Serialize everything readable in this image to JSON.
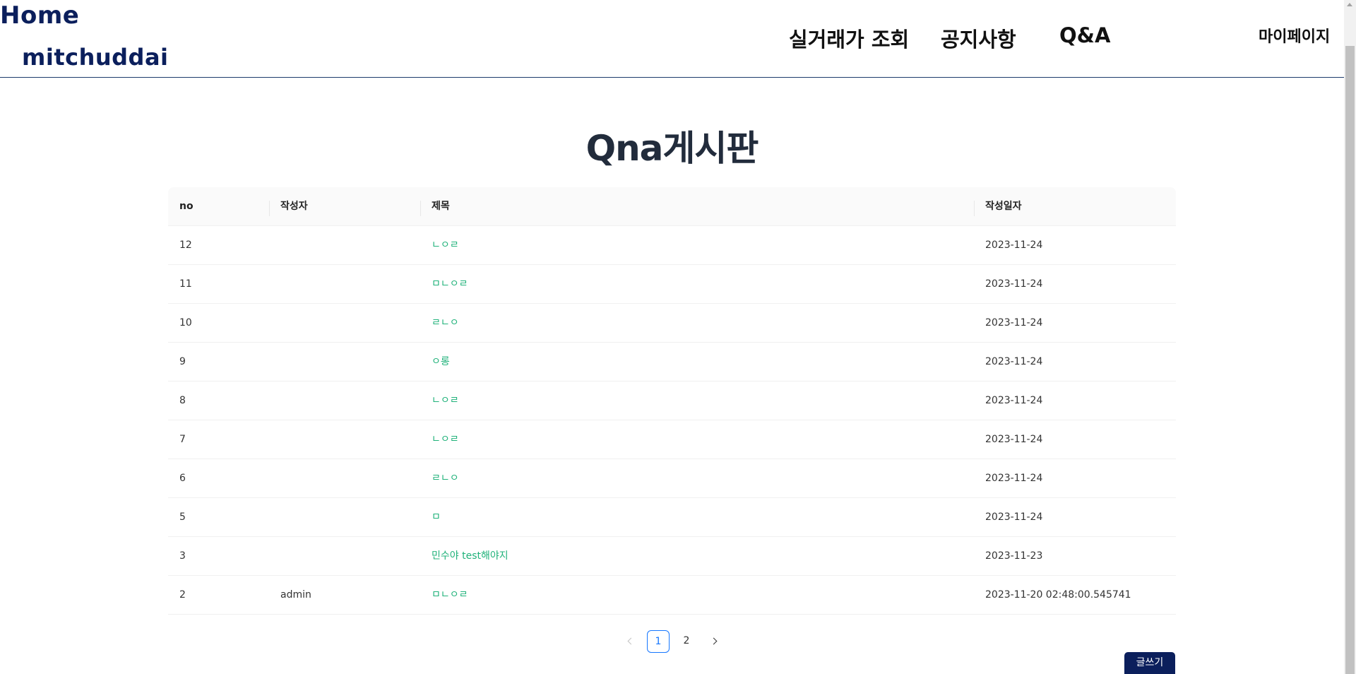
{
  "header": {
    "logo_line1": "Home",
    "logo_line2": "mitchuddai",
    "nav": {
      "trade": "실거래가 조회",
      "notice": "공지사항",
      "qna": "Q&A"
    },
    "mypage": "마이페이지"
  },
  "page_title": "Qna게시판",
  "table": {
    "columns": {
      "no": "no",
      "writer": "작성자",
      "title": "제목",
      "date": "작성일자"
    },
    "rows": [
      {
        "no": "12",
        "writer": "",
        "title": "ㄴㅇㄹ",
        "date": "2023-11-24"
      },
      {
        "no": "11",
        "writer": "",
        "title": "ㅁㄴㅇㄹ",
        "date": "2023-11-24"
      },
      {
        "no": "10",
        "writer": "",
        "title": "ㄹㄴㅇ",
        "date": "2023-11-24"
      },
      {
        "no": "9",
        "writer": "",
        "title": "ㅇ롱",
        "date": "2023-11-24"
      },
      {
        "no": "8",
        "writer": "",
        "title": "ㄴㅇㄹ",
        "date": "2023-11-24"
      },
      {
        "no": "7",
        "writer": "",
        "title": "ㄴㅇㄹ",
        "date": "2023-11-24"
      },
      {
        "no": "6",
        "writer": "",
        "title": "ㄹㄴㅇ",
        "date": "2023-11-24"
      },
      {
        "no": "5",
        "writer": "",
        "title": "ㅁ",
        "date": "2023-11-24"
      },
      {
        "no": "3",
        "writer": "",
        "title": "민수야 test해야지",
        "date": "2023-11-23"
      },
      {
        "no": "2",
        "writer": "admin",
        "title": "ㅁㄴㅇㄹ",
        "date": "2023-11-20 02:48:00.545741"
      }
    ]
  },
  "pagination": {
    "pages": [
      "1",
      "2"
    ],
    "current": "1"
  },
  "write_button": "글쓰기",
  "colors": {
    "brand": "#0b1f5c",
    "link": "#20b27a",
    "active_page": "#1677ff"
  }
}
